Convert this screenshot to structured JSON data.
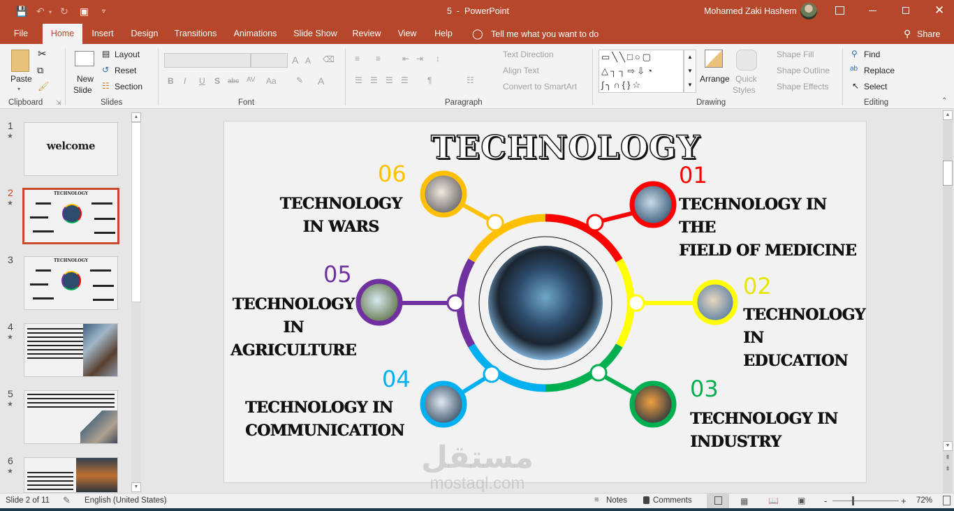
{
  "titlebar": {
    "doc_title": "5  -  PowerPoint",
    "user_name": "Mohamed Zaki Hashem",
    "qat": [
      "save-icon",
      "undo-icon",
      "redo-icon",
      "start-from-beginning-icon",
      "customize-qat-icon"
    ]
  },
  "tabs": [
    {
      "label": "File"
    },
    {
      "label": "Home"
    },
    {
      "label": "Insert"
    },
    {
      "label": "Design"
    },
    {
      "label": "Transitions"
    },
    {
      "label": "Animations"
    },
    {
      "label": "Slide Show"
    },
    {
      "label": "Review"
    },
    {
      "label": "View"
    },
    {
      "label": "Help"
    }
  ],
  "tell_me": "Tell me what you want to do",
  "share": "Share",
  "ribbon": {
    "clipboard": {
      "paste": "Paste",
      "label": "Clipboard"
    },
    "slides": {
      "new_slide_1": "New",
      "new_slide_2": "Slide",
      "layout": "Layout",
      "reset": "Reset",
      "section": "Section",
      "label": "Slides"
    },
    "font": {
      "label": "Font",
      "bold": "B",
      "italic": "I",
      "underline": "U",
      "shadow": "S",
      "strike": "abc",
      "spacing": "AV",
      "case": "Aa",
      "grow": "A",
      "shrink": "A",
      "color": "A"
    },
    "paragraph": {
      "label": "Paragraph",
      "text_direction": "Text Direction",
      "align_text": "Align Text",
      "smartart": "Convert to SmartArt"
    },
    "drawing": {
      "label": "Drawing",
      "arrange": "Arrange",
      "quick_1": "Quick",
      "quick_2": "Styles",
      "shape_fill": "Shape Fill",
      "shape_outline": "Shape Outline",
      "shape_effects": "Shape Effects"
    },
    "editing": {
      "label": "Editing",
      "find": "Find",
      "replace": "Replace",
      "select": "Select"
    }
  },
  "thumbnails": [
    {
      "num": "1",
      "title": "welcome"
    },
    {
      "num": "2",
      "title": "TECHNOLOGY",
      "selected": true
    },
    {
      "num": "3",
      "title": "TECHNOLOGY"
    },
    {
      "num": "4",
      "title": ""
    },
    {
      "num": "5",
      "title": ""
    },
    {
      "num": "6",
      "title": ""
    }
  ],
  "slide": {
    "title": "TECHNOLOGY",
    "items": [
      {
        "num": "01",
        "color": "#ff0000",
        "line1": "TECHNOLOGY IN THE",
        "line2": "FIELD OF MEDICINE",
        "line3": ""
      },
      {
        "num": "02",
        "color": "#ffff00",
        "line1": "TECHNOLOGY",
        "line2": "IN EDUCATION",
        "line3": ""
      },
      {
        "num": "03",
        "color": "#00b050",
        "line1": "TECHNOLOGY IN",
        "line2": "INDUSTRY",
        "line3": ""
      },
      {
        "num": "04",
        "color": "#00b0f0",
        "line1": "TECHNOLOGY IN",
        "line2": "COMMUNICATION",
        "line3": ""
      },
      {
        "num": "05",
        "color": "#7030a0",
        "line1": "TECHNOLOGY",
        "line2": "IN",
        "line3": "AGRICULTURE"
      },
      {
        "num": "06",
        "color": "#ffc000",
        "line1": "TECHNOLOGY",
        "line2": "IN WARS",
        "line3": ""
      }
    ]
  },
  "watermark": {
    "arabic": "مستقل",
    "latin": "mostaql.com"
  },
  "status": {
    "slide_info": "Slide 2 of 11",
    "language": "English (United States)",
    "notes": "Notes",
    "comments": "Comments",
    "zoom": "72%",
    "zoom_minus": "-",
    "zoom_plus": "+"
  }
}
